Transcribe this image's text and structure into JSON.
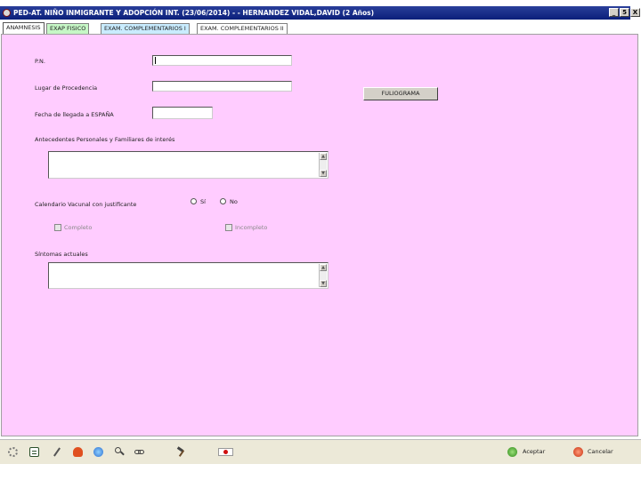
{
  "window": {
    "title": "PED-AT. NIÑO INMIGRANTE Y ADOPCIÓN INT. (23/06/2014) - - HERNANDEZ VIDAL,DAVID (2 Años)",
    "minimize": "_",
    "maximize": "5",
    "close": "X"
  },
  "tabs": [
    {
      "label": "ANAMNESIS"
    },
    {
      "label": "EXAP FISICO"
    },
    {
      "label": "EXAM. COMPLEMENTARIOS I"
    },
    {
      "label": "EXAM. COMPLEMENTARIOS II"
    }
  ],
  "form": {
    "pn_label": "P.N.",
    "pn_value": "",
    "lugar_label": "Lugar de Procedencia",
    "lugar_value": "",
    "fecha_label": "Fecha de llegada a ESPAÑA",
    "fecha_value": "",
    "fuliograma_button": "FULIOGRAMA",
    "antecedentes_label": "Antecedentes Personales y Familiares de interés",
    "antecedentes_value": "",
    "calendario_label": "Calendario Vacunal con justificante",
    "radio_si": "Sí",
    "radio_no": "No",
    "check_completo": "Completo",
    "check_incompleto": "Incompleto",
    "sintomas_label": "Síntomas actuales",
    "sintomas_value": ""
  },
  "footer": {
    "aceptar": "Aceptar",
    "cancelar": "Cancelar"
  },
  "colors": {
    "panel_bg": "#ffccff",
    "titlebar": "#0a1f7a",
    "tab_fisico": "#c6f7c6",
    "tab_comp1": "#c9ecff"
  }
}
